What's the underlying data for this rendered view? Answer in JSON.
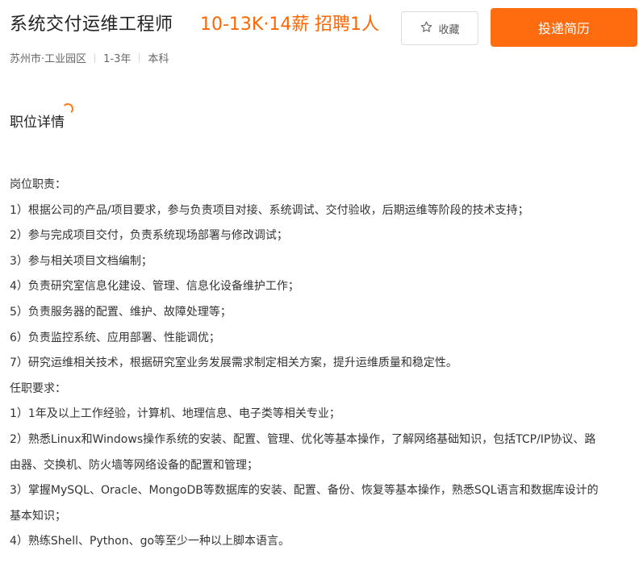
{
  "job": {
    "title": "系统交付运维工程师",
    "salary": "10-13K·14薪",
    "hiring": "招聘1人",
    "location": "苏州市·工业园区",
    "experience": "1-3年",
    "education": "本科"
  },
  "actions": {
    "favorite_label": "收藏",
    "apply_label": "投递简历"
  },
  "section": {
    "title": "职位详情"
  },
  "description": {
    "lines": [
      "岗位职责：",
      "1）根据公司的产品/项目要求，参与负责项目对接、系统调试、交付验收，后期运维等阶段的技术支持；",
      "2）参与完成项目交付，负责系统现场部署与修改调试；",
      "3）参与相关项目文档编制；",
      "4）负责研究室信息化建设、管理、信息化设备维护工作；",
      "5）负责服务器的配置、维护、故障处理等；",
      "6）负责监控系统、应用部署、性能调优；",
      "7）研究运维相关技术，根据研究室业务发展需求制定相关方案，提升运维质量和稳定性。",
      "任职要求：",
      "1）1年及以上工作经验，计算机、地理信息、电子类等相关专业；",
      "2）熟悉Linux和Windows操作系统的安装、配置、管理、优化等基本操作，了解网络基础知识，包括TCP/IP协议、路",
      "由器、交换机、防火墙等网络设备的配置和管理；",
      "3）掌握MySQL、Oracle、MongoDB等数据库的安装、配置、备份、恢复等基本操作，熟悉SQL语言和数据库设计的",
      "基本知识；",
      "4）熟练Shell、Python、go等至少一种以上脚本语言。"
    ]
  },
  "colors": {
    "accent": "#ff6600",
    "apply_button": "#ff6b0f"
  },
  "icons": {
    "favorite": "star-outline-icon"
  }
}
